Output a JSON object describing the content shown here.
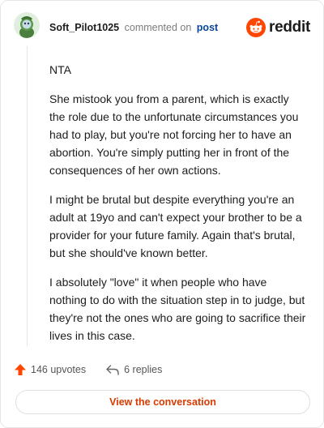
{
  "header": {
    "username": "Soft_Pilot1025",
    "commented_text": "commented on",
    "post_link": "post",
    "brand": "reddit"
  },
  "comment": {
    "paragraphs": [
      "NTA",
      "She mistook you from a parent, which is exactly the role due to the unfortunate circumstances you had to play, but you're not forcing her to have an abortion. You're simply putting her in front of the consequences of her own actions.",
      "I might be brutal but despite everything you're an adult at 19yo and can't expect your brother to be a provider for your future family. Again that's brutal, but she should've known better.",
      "I absolutely \"love\" it when people who have nothing to do with the situation step in to judge, but they're not the ones who are going to sacrifice their lives in this case."
    ]
  },
  "actions": {
    "upvotes": "146 upvotes",
    "replies": "6 replies"
  },
  "cta": {
    "label": "View the conversation"
  },
  "colors": {
    "accent": "#d93a00",
    "reddit_orange": "#ff4500",
    "link_blue": "#0a449b",
    "upvote_arrow": "#ff4500"
  },
  "icons": {
    "avatar": "snoo-avatar-icon",
    "brand": "reddit-logo-icon",
    "upvote": "upvote-arrow-icon",
    "reply": "reply-arrow-icon"
  }
}
